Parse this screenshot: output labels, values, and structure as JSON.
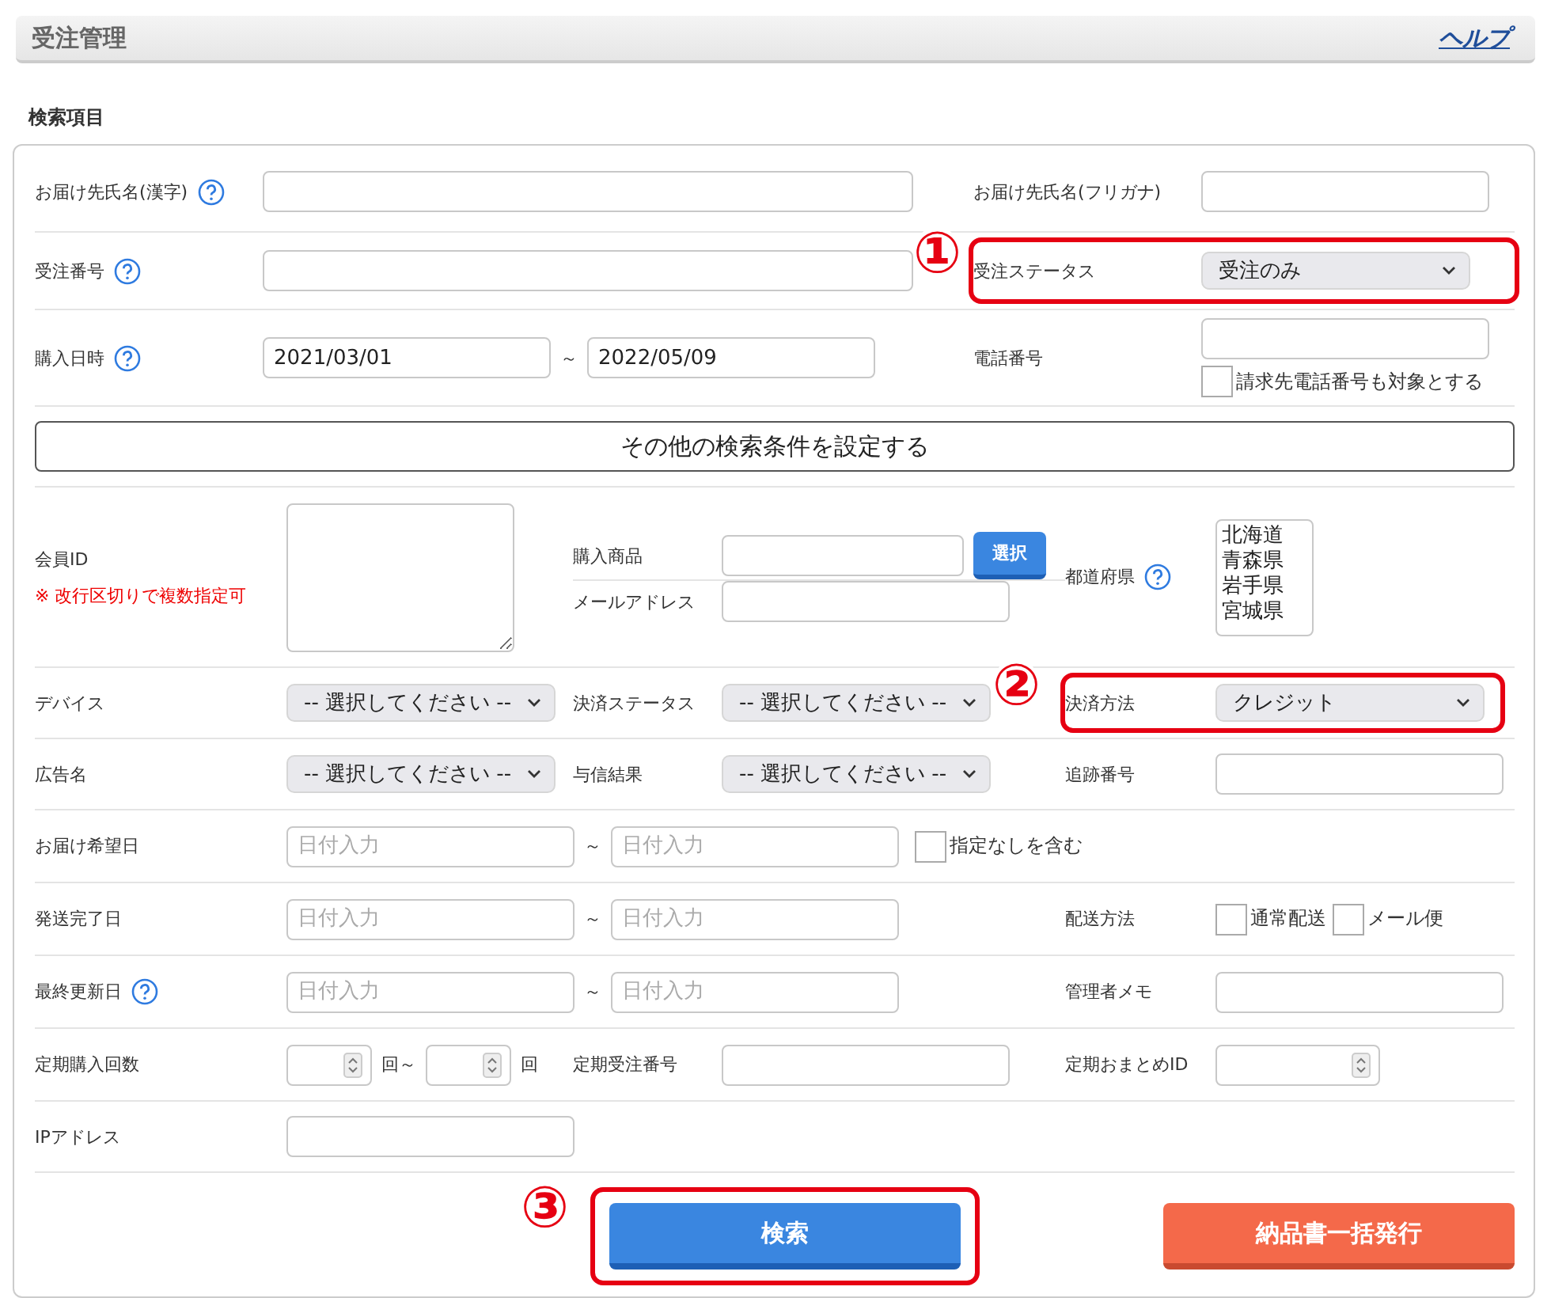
{
  "header": {
    "title": "受注管理",
    "help_link": "ヘルプ"
  },
  "section_title": "検索項目",
  "top_rows": [
    {
      "cells": [
        {
          "label": "お届け先氏名(漢字)",
          "has_help": true,
          "kind": "text"
        },
        {
          "label": "お届け先氏名(フリガナ)",
          "kind": "text"
        }
      ]
    },
    {
      "cells": [
        {
          "label": "受注番号",
          "has_help": true,
          "kind": "text"
        },
        {
          "label": "受注ステータス",
          "kind": "select",
          "value": "受注のみ",
          "annotation": "①"
        }
      ]
    },
    {
      "cells": [
        {
          "label": "購入日時",
          "has_help": true,
          "kind": "date_range",
          "from": "2021/03/01",
          "separator": "～",
          "to": "2022/05/09"
        },
        {
          "label": "電話番号",
          "kind": "text",
          "checkbox": {
            "label": "請求先電話番号も対象とする",
            "checked": false
          }
        }
      ]
    }
  ],
  "more_conditions_button": "その他の検索条件を設定する",
  "lower_rows": [
    {
      "cells": [
        {
          "label": "会員ID",
          "note": "※ 改行区切りで複数指定可",
          "kind": "textarea"
        },
        {
          "kind": "stack",
          "items": [
            {
              "label": "購入商品",
              "kind": "text",
              "button": "選択"
            },
            {
              "label": "メールアドレス",
              "kind": "text"
            }
          ]
        },
        {
          "label": "都道府県",
          "has_help": true,
          "kind": "listbox",
          "options": [
            "北海道",
            "青森県",
            "岩手県",
            "宮城県"
          ]
        }
      ]
    },
    {
      "cells": [
        {
          "label": "デバイス",
          "kind": "select",
          "value": "-- 選択してください --"
        },
        {
          "label": "決済ステータス",
          "kind": "select",
          "value": "-- 選択してください --"
        },
        {
          "label": "決済方法",
          "kind": "select",
          "value": "クレジット",
          "annotation": "②"
        }
      ]
    },
    {
      "cells": [
        {
          "label": "広告名",
          "kind": "select",
          "value": "-- 選択してください --"
        },
        {
          "label": "与信結果",
          "kind": "select",
          "value": "-- 選択してください --"
        },
        {
          "label": "追跡番号",
          "kind": "text"
        }
      ]
    },
    {
      "cells": [
        {
          "label": "お届け希望日",
          "kind": "date_range",
          "from_placeholder": "日付入力",
          "separator": "～",
          "to_placeholder": "日付入力",
          "checkbox": {
            "label": "指定なしを含む",
            "checked": false
          }
        }
      ]
    },
    {
      "cells": [
        {
          "label": "発送完了日",
          "kind": "date_range",
          "from_placeholder": "日付入力",
          "separator": "～",
          "to_placeholder": "日付入力"
        },
        {
          "label": "配送方法",
          "kind": "checkboxes",
          "options": [
            {
              "label": "通常配送",
              "checked": false
            },
            {
              "label": "メール便",
              "checked": false
            }
          ]
        }
      ]
    },
    {
      "cells": [
        {
          "label": "最終更新日",
          "has_help": true,
          "kind": "date_range",
          "from_placeholder": "日付入力",
          "separator": "～",
          "to_placeholder": "日付入力"
        },
        {
          "label": "管理者メモ",
          "kind": "text"
        }
      ]
    },
    {
      "cells": [
        {
          "label": "定期購入回数",
          "kind": "number_range",
          "unit_from": "回～",
          "unit_to": "回"
        },
        {
          "label": "定期受注番号",
          "kind": "text"
        },
        {
          "label": "定期おまとめID",
          "kind": "number"
        }
      ]
    },
    {
      "cells": [
        {
          "label": "IPアドレス",
          "kind": "text"
        }
      ]
    }
  ],
  "actions": [
    {
      "label": "検索",
      "kind": "primary",
      "annotation": "③"
    },
    {
      "label": "納品書一括発行",
      "kind": "danger"
    }
  ]
}
